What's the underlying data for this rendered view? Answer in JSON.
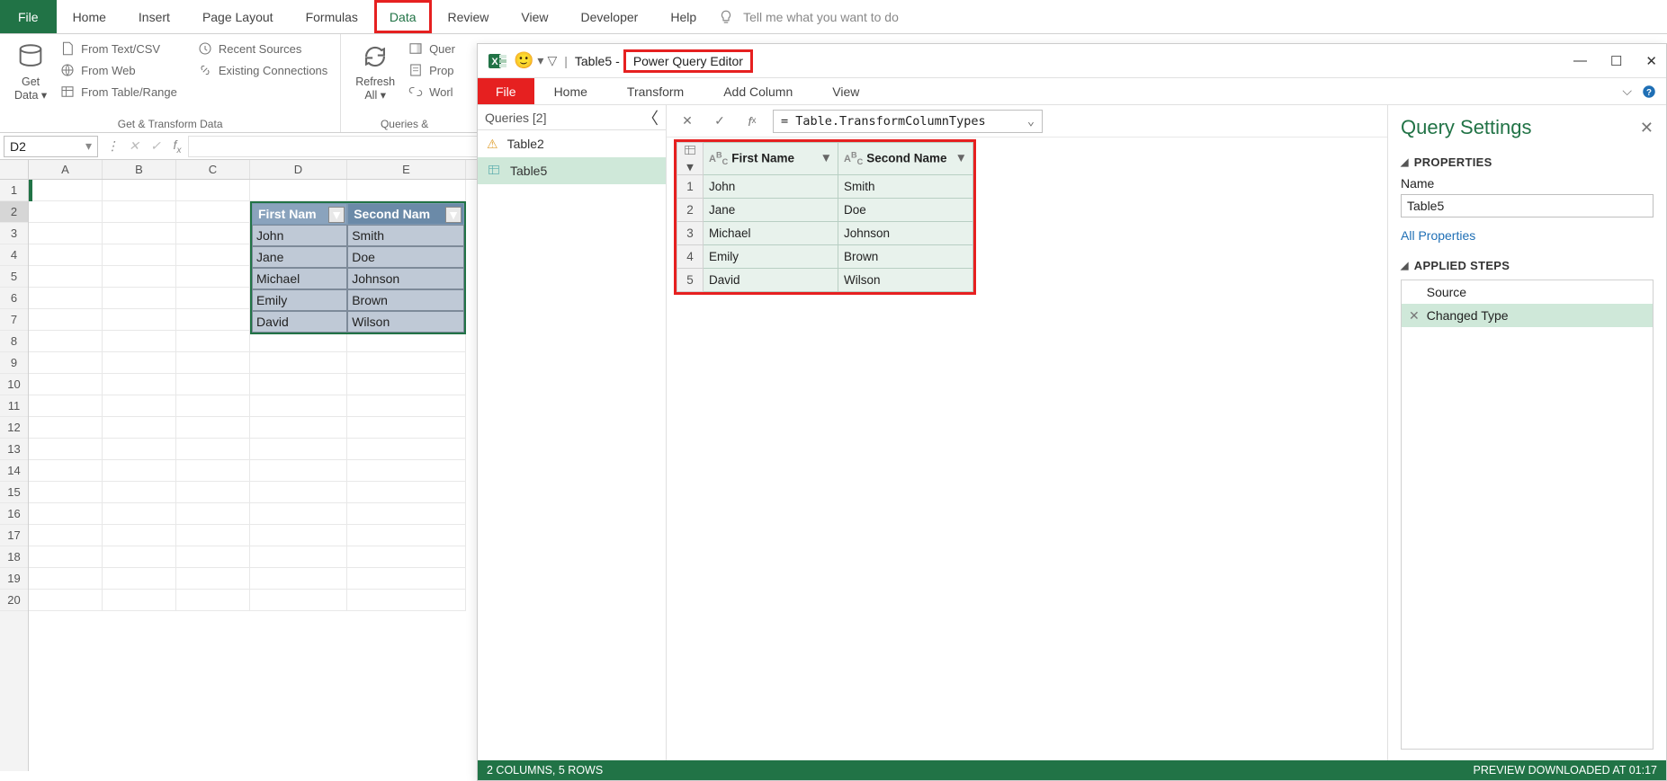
{
  "excel": {
    "tabs": {
      "file": "File",
      "home": "Home",
      "insert": "Insert",
      "pagelayout": "Page Layout",
      "formulas": "Formulas",
      "data": "Data",
      "review": "Review",
      "view": "View",
      "developer": "Developer",
      "help": "Help"
    },
    "tellme_placeholder": "Tell me what you want to do",
    "ribbon": {
      "getdata": "Get\nData",
      "from_text": "From Text/CSV",
      "from_web": "From Web",
      "from_table": "From Table/Range",
      "recent": "Recent Sources",
      "existing": "Existing Connections",
      "group1": "Get & Transform Data",
      "refresh": "Refresh\nAll",
      "queries_btn": "Quer",
      "properties": "Prop",
      "worklinks": "Worl",
      "group2": "Queries &"
    },
    "namebox": "D2",
    "columns": [
      "A",
      "B",
      "C",
      "D",
      "E"
    ],
    "table": {
      "headers": [
        "First Nam",
        "Second Nam"
      ],
      "rows": [
        [
          "John",
          "Smith"
        ],
        [
          "Jane",
          "Doe"
        ],
        [
          "Michael",
          "Johnson"
        ],
        [
          "Emily",
          "Brown"
        ],
        [
          "David",
          "Wilson"
        ]
      ]
    }
  },
  "pq": {
    "title_left": "Table5",
    "title_app": "Power Query Editor",
    "tabs": {
      "file": "File",
      "home": "Home",
      "transform": "Transform",
      "addcol": "Add Column",
      "view": "View"
    },
    "queries_header": "Queries [2]",
    "queries": [
      {
        "name": "Table2",
        "warn": true
      },
      {
        "name": "Table5",
        "warn": false,
        "selected": true
      }
    ],
    "formula": "= Table.TransformColumnTypes",
    "grid": {
      "headers": [
        "First Name",
        "Second Name"
      ],
      "rows": [
        [
          "John",
          "Smith"
        ],
        [
          "Jane",
          "Doe"
        ],
        [
          "Michael",
          "Johnson"
        ],
        [
          "Emily",
          "Brown"
        ],
        [
          "David",
          "Wilson"
        ]
      ]
    },
    "settings": {
      "title": "Query Settings",
      "properties": "PROPERTIES",
      "name_label": "Name",
      "name_value": "Table5",
      "all_props": "All Properties",
      "applied": "APPLIED STEPS",
      "steps": [
        {
          "name": "Source"
        },
        {
          "name": "Changed Type",
          "selected": true
        }
      ]
    },
    "status_left": "2 COLUMNS, 5 ROWS",
    "status_right": "PREVIEW DOWNLOADED AT 01:17"
  }
}
